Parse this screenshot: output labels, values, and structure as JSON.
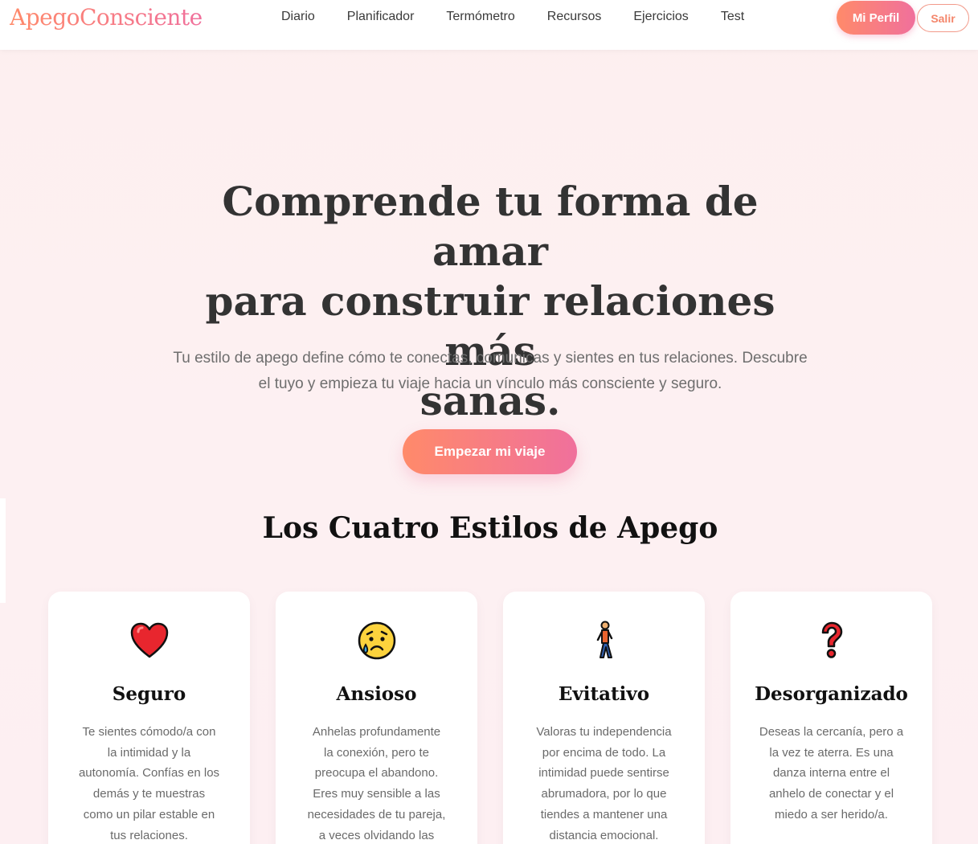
{
  "header": {
    "logo": "ApegoConsciente",
    "nav": [
      "Diario",
      "Planificador",
      "Termómetro",
      "Recursos",
      "Ejercicios",
      "Test"
    ],
    "profile_button": "Mi Perfil",
    "exit_button": "Salir"
  },
  "hero": {
    "title_lines": [
      "Comprende tu forma de amar",
      "para construir relaciones más",
      "sanas."
    ],
    "subtitle_lines": [
      "Tu estilo de apego define cómo te conectas, comunicas y sientes en tus relaciones. Descubre",
      "el tuyo y empieza tu viaje hacia un vínculo más consciente y seguro."
    ],
    "cta": "Empezar mi viaje"
  },
  "styles_section": {
    "title": "Los Cuatro Estilos de Apego",
    "cards": [
      {
        "icon": "heart-icon",
        "title": "Seguro",
        "text_lines": [
          "Te sientes cómodo/a con",
          "la intimidad y la",
          "autonomía. Confías en los",
          "demás y te muestras",
          "como un pilar estable en",
          "tus relaciones."
        ]
      },
      {
        "icon": "sad-tear-face-icon",
        "title": "Ansioso",
        "text_lines": [
          "Anhelas profundamente",
          "la conexión, pero te",
          "preocupa el abandono.",
          "Eres muy sensible a las",
          "necesidades de tu pareja,",
          "a veces olvidando las"
        ]
      },
      {
        "icon": "walking-person-icon",
        "title": "Evitativo",
        "text_lines": [
          "Valoras tu independencia",
          "por encima de todo. La",
          "intimidad puede sentirse",
          "abrumadora, por lo que",
          "tiendes a mantener una",
          "distancia emocional."
        ]
      },
      {
        "icon": "question-mark-icon",
        "title": "Desorganizado",
        "text_lines": [
          "Deseas la cercanía, pero a",
          "la vez te aterra. Es una",
          "danza interna entre el",
          "anhelo de conectar y el",
          "miedo a ser herido/a."
        ]
      }
    ]
  },
  "colors": {
    "accent_start": "#ff8a6a",
    "accent_end": "#f0709c",
    "heading": "#333333",
    "body_text": "#6e6e6e"
  }
}
